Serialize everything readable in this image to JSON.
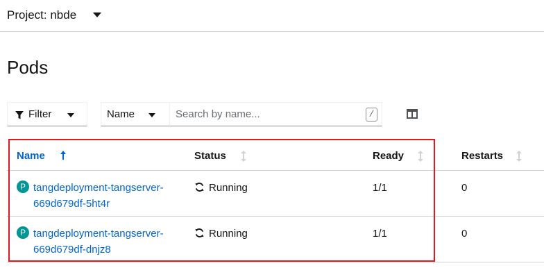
{
  "project": {
    "label": "Project: nbde"
  },
  "page": {
    "title": "Pods"
  },
  "toolbar": {
    "filter_label": "Filter",
    "search_by_label": "Name",
    "search_placeholder": "Search by name...",
    "shortcut_key": "/"
  },
  "table": {
    "headers": {
      "name": "Name",
      "status": "Status",
      "ready": "Ready",
      "restarts": "Restarts"
    },
    "sort": {
      "column": "Name",
      "direction": "ascending"
    },
    "rows": [
      {
        "badge": "P",
        "name_line1": "tangdeployment-tangserver-",
        "name_line2": "669d679df-5ht4r",
        "status": "Running",
        "ready": "1/1",
        "restarts": "0"
      },
      {
        "badge": "P",
        "name_line1": "tangdeployment-tangserver-",
        "name_line2": "669d679df-dnjz8",
        "status": "Running",
        "ready": "1/1",
        "restarts": "0"
      }
    ]
  },
  "colors": {
    "link": "#0066cc",
    "badge": "#009596",
    "highlight": "#e8141f"
  },
  "icons": {
    "project_dropdown": "caret-down-icon",
    "filter": "filter-icon",
    "columns": "manage-columns-icon",
    "sort_active": "arrow-up-icon",
    "sort_inactive": "sort-arrows-icon",
    "status": "sync-icon"
  }
}
